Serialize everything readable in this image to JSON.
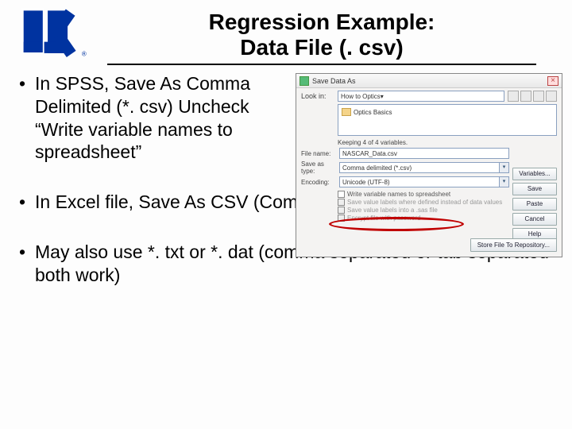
{
  "title": {
    "line1": "Regression Example:",
    "line2": "Data File (. csv)"
  },
  "bullets": {
    "b1": "In SPSS, Save As Comma Delimited (*. csv) Uncheck “Write variable names to spreadsheet”",
    "b2": "In Excel file, Save As CSV (Comma Delimited) (*. csv)",
    "b3": "May also use *. txt or *. dat (comma separated or tab separated both work)"
  },
  "dialog": {
    "title": "Save Data As",
    "lookin_label": "Look in:",
    "lookin_value": "How to Optics",
    "folder_item": "Optics Basics",
    "keeping": "Keeping 4 of 4 variables.",
    "filename_label": "File name:",
    "filename_value": "NASCAR_Data.csv",
    "saveas_label": "Save as type:",
    "saveas_value": "Comma delimited (*.csv)",
    "encoding_label": "Encoding:",
    "encoding_value": "Unicode (UTF-8)",
    "checks": {
      "c1": "Write variable names to spreadsheet",
      "c2": "Save value labels where defined instead of data values",
      "c3": "Save value labels into a .sas file",
      "c4": "Encrypt file with password"
    },
    "buttons": {
      "variables": "Variables...",
      "save": "Save",
      "paste": "Paste",
      "cancel": "Cancel",
      "help": "Help",
      "store": "Store File To Repository..."
    }
  }
}
